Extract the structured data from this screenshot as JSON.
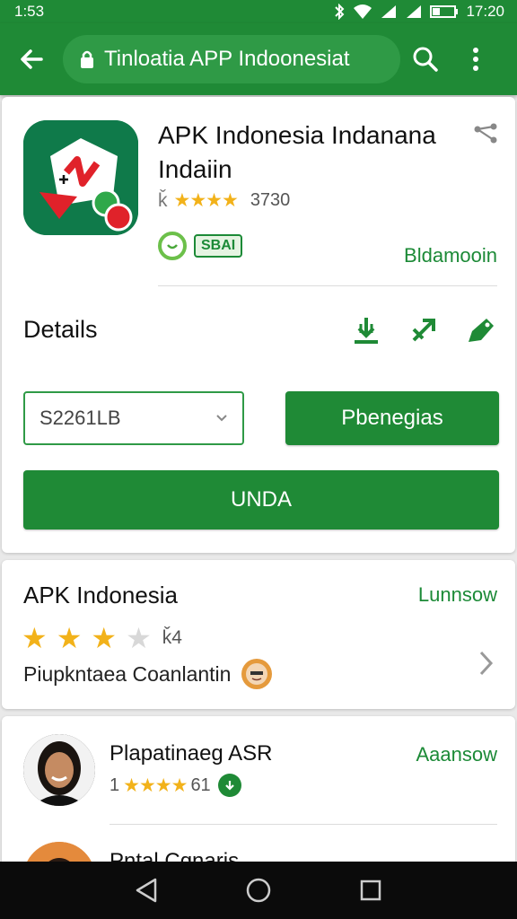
{
  "status_bar": {
    "time_left": "1:53",
    "time_right": "17:20"
  },
  "toolbar": {
    "url_title": "Tinloatia APP Indoonesiat"
  },
  "app": {
    "title": "APK Indonesia Indanana Indaiin",
    "rating_prefix": "ǩ",
    "stars": "★★★★",
    "rating_count": "3730",
    "badge_label": "SBAI",
    "developer_link": "Bldamooin"
  },
  "details": {
    "title": "Details",
    "version_value": "S2261LB",
    "secondary_button": "Pbenegias",
    "primary_button": "UNDA"
  },
  "rating_card": {
    "title": "APK Indonesia",
    "link": "Lunnsow",
    "stars_on": [
      "★",
      "★",
      "★"
    ],
    "stars_off": [
      "★"
    ],
    "score": "ǩ4",
    "subtitle": "Piupkntaea Coanlantin"
  },
  "list": [
    {
      "name": "Plapatinaeg ASR",
      "rating_prefix": "1",
      "stars": "★★★★",
      "rating_count": "61",
      "link": "Aaansow"
    },
    {
      "name": "Pntal Cqnaris",
      "rating_prefix": "",
      "stars": "",
      "rating_count": "",
      "link": ""
    }
  ],
  "colors": {
    "brand_green": "#1f8a36",
    "star_yellow": "#f2b21a",
    "link_green": "#1c8a37"
  },
  "icons": {
    "toolbar": [
      "back-arrow-icon",
      "lock-icon",
      "search-icon",
      "more-vert-icon"
    ],
    "actions": [
      "download-icon",
      "expand-icon",
      "tag-icon"
    ],
    "nav": [
      "nav-back-icon",
      "nav-home-icon",
      "nav-recents-icon"
    ]
  }
}
